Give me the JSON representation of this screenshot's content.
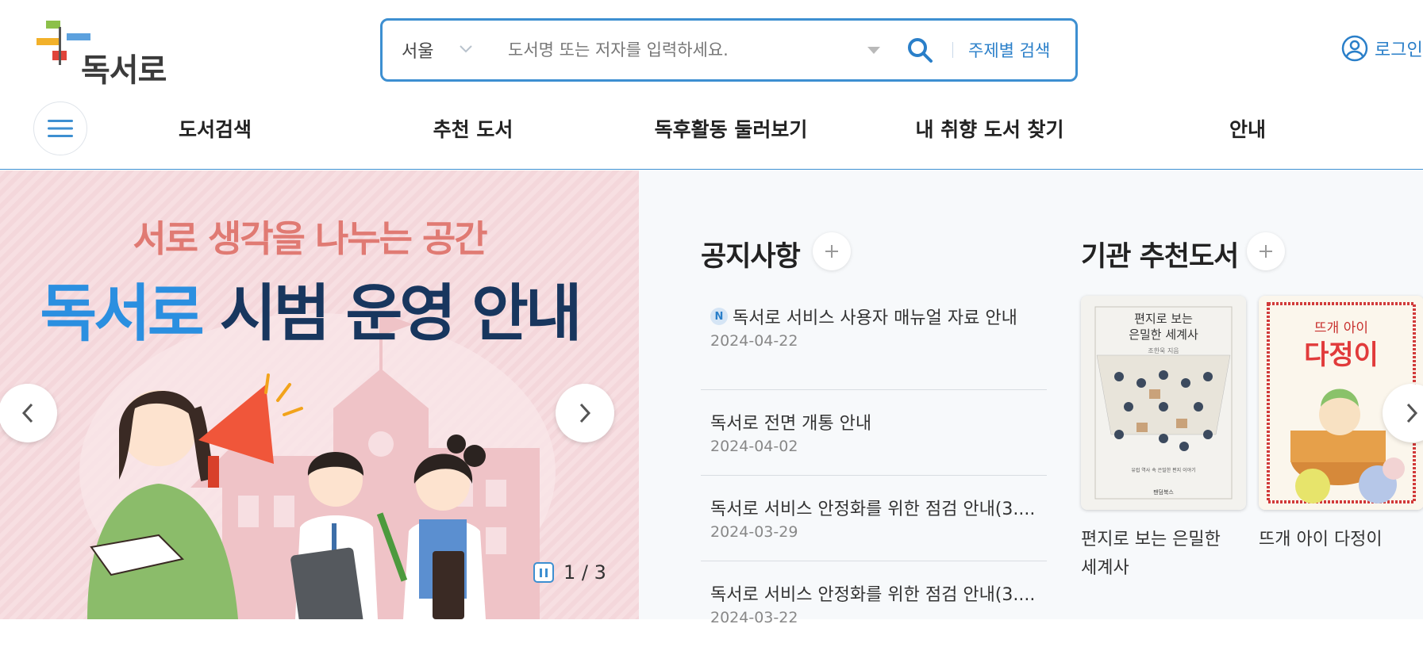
{
  "header": {
    "logo_text": "독서로",
    "search": {
      "region": "서울",
      "placeholder": "도서명 또는 저자를 입력하세요.",
      "subject_search_label": "주제별 검색"
    },
    "login_label": "로그인"
  },
  "nav": {
    "items": [
      "도서검색",
      "추천 도서",
      "독후활동 둘러보기",
      "내 취향 도서 찾기",
      "안내"
    ]
  },
  "banner": {
    "subtitle": "서로 생각을 나누는 공간",
    "title_part1": "독서로",
    "title_part2": "시범 운영 안내",
    "pager": "1 / 3"
  },
  "notices": {
    "title": "공지사항",
    "new_badge": "N",
    "items": [
      {
        "title": "독서로 서비스 사용자 매뉴얼 자료 안내",
        "date": "2024-04-22"
      },
      {
        "title": "독서로 전면 개통 안내",
        "date": "2024-04-02"
      },
      {
        "title": "독서로 서비스 안정화를 위한 점검 안내(3....",
        "date": "2024-03-29"
      },
      {
        "title": "독서로 서비스 안정화를 위한 점검 안내(3....",
        "date": "2024-03-22"
      }
    ]
  },
  "recommended": {
    "title": "기관 추천도서",
    "books": [
      {
        "title": "편지로 보는 은밀한 세계사",
        "cover_title": "편지로 보는\n은밀한 세계사",
        "cover_color": "#f3f2ee"
      },
      {
        "title": "뜨개 아이 다정이",
        "cover_top": "뜨개 아이",
        "cover_main": "다정이",
        "cover_color": "#fbf6ec"
      }
    ]
  },
  "colors": {
    "accent": "#3d8fd1",
    "link": "#2a7fc9",
    "banner_bg": "#f6dbdf"
  }
}
